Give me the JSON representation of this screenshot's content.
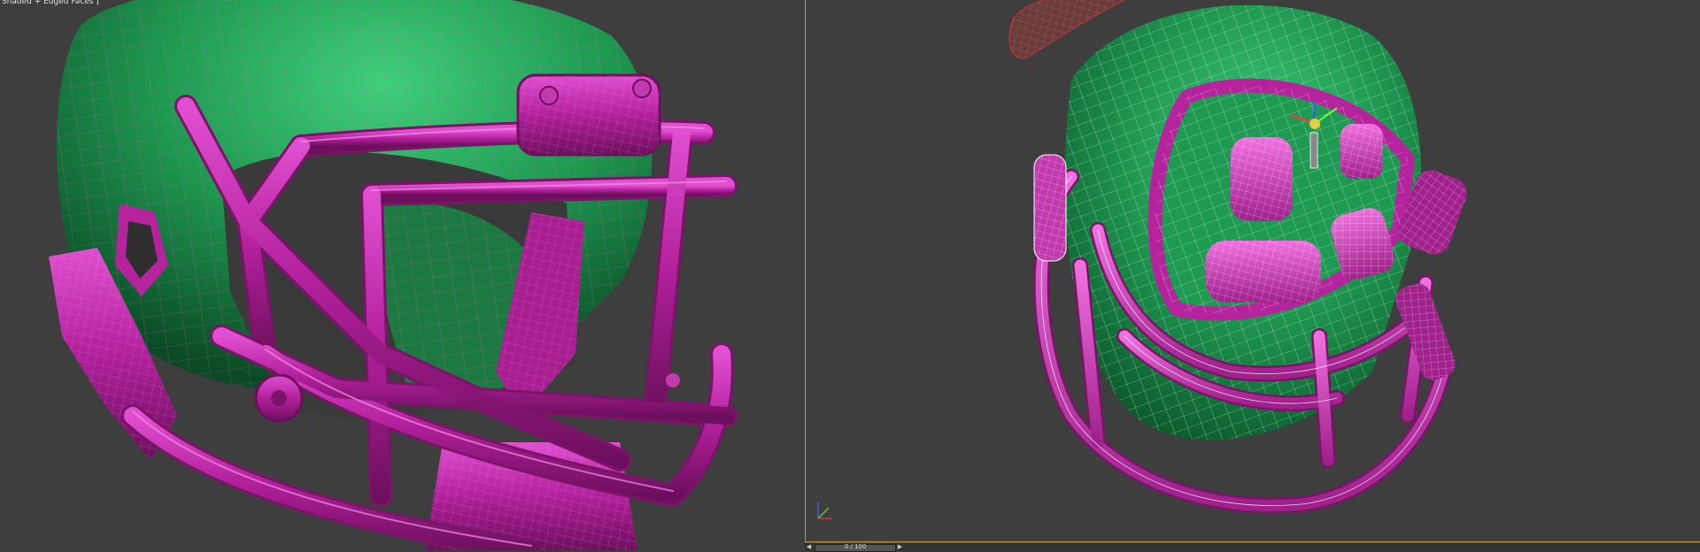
{
  "viewports": {
    "left": {
      "label": "Shaded + Edged Faces ]"
    },
    "right": {
      "label": ""
    }
  },
  "timeline": {
    "frame_text": "0 / 100"
  },
  "colors": {
    "background": "#3e3e3e",
    "helmet_shell": "#1f8a4a",
    "facemask": "#b5249c",
    "wire_left": "#d65fc5",
    "wire_right": "#ffffff",
    "active_border": "#b89a3a"
  },
  "icons": [
    "axis-tripod-icon",
    "transform-gizmo-icon",
    "chevron-left-icon",
    "chevron-right-icon"
  ]
}
